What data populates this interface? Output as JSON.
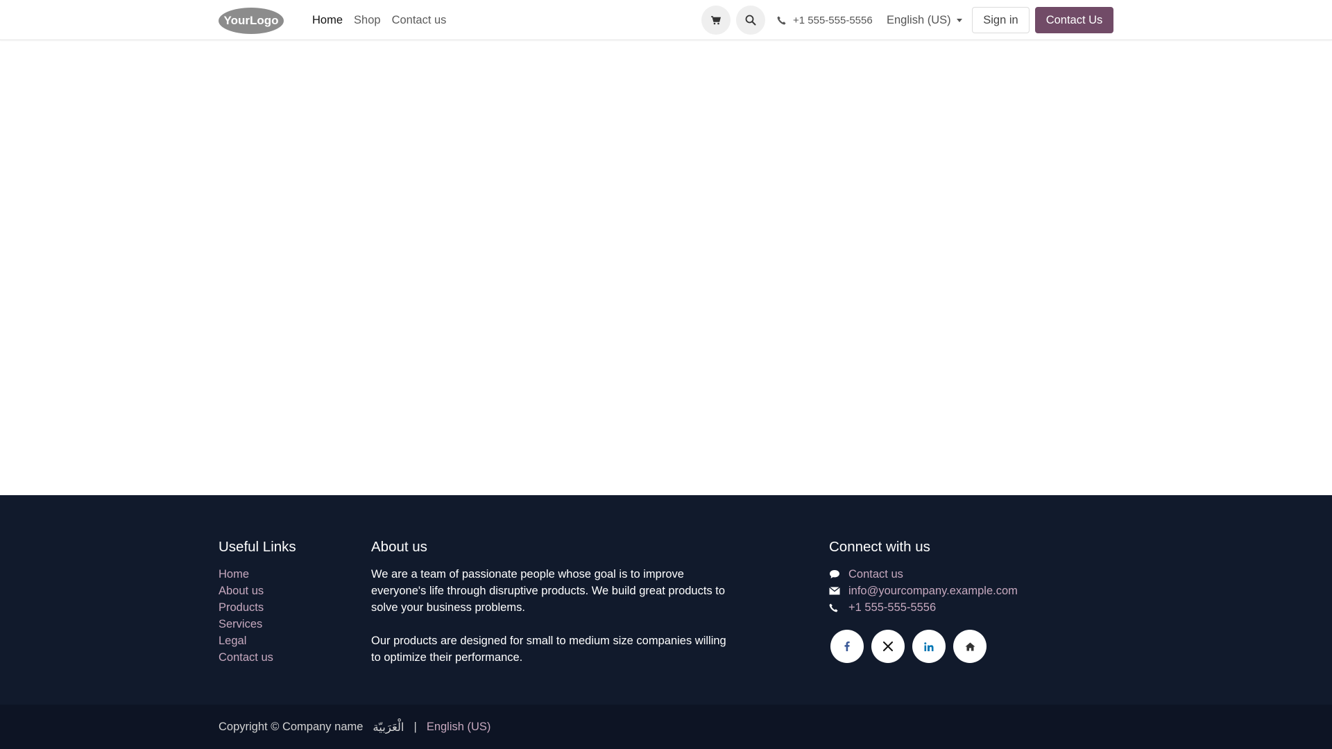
{
  "header": {
    "logo_text": "YourLogo",
    "nav": [
      {
        "label": "Home",
        "active": true
      },
      {
        "label": "Shop",
        "active": false
      },
      {
        "label": "Contact us",
        "active": false
      }
    ],
    "phone": "+1 555-555-5556",
    "language": "English (US)",
    "signin_label": "Sign in",
    "contact_label": "Contact Us",
    "accent_color": "#714b67"
  },
  "footer": {
    "useful_links": {
      "title": "Useful Links",
      "items": [
        "Home",
        "About us",
        "Products",
        "Services",
        "Legal",
        "Contact us"
      ]
    },
    "about": {
      "title": "About us",
      "paragraphs": [
        "We are a team of passionate people whose goal is to improve everyone's life through disruptive products. We build great products to solve your business problems.",
        "Our products are designed for small to medium size companies willing to optimize their performance."
      ]
    },
    "connect": {
      "title": "Connect with us",
      "contact_label": "Contact us",
      "email": "info@yourcompany.example.com",
      "phone": "+1 555-555-5556",
      "socials": [
        "facebook-icon",
        "x-icon",
        "linkedin-icon",
        "home-icon"
      ]
    },
    "background": "#111a2c",
    "link_color": "#c7a9bf"
  },
  "copyright": {
    "text": "Copyright © Company name",
    "arabic": "الْعَرَبيّة",
    "separator": "|",
    "language": "English (US)"
  }
}
